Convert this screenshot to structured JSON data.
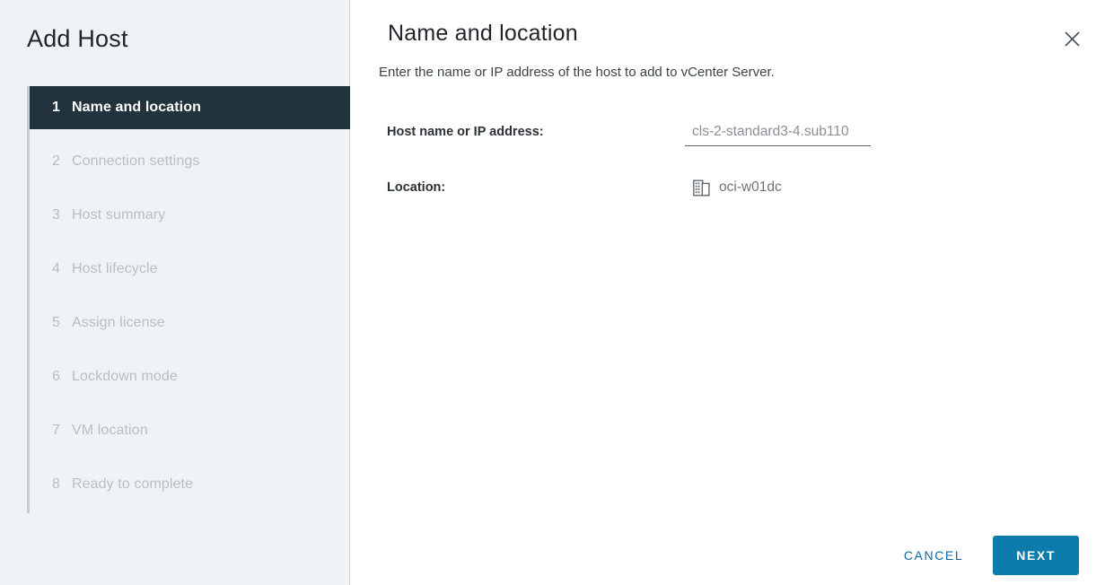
{
  "wizard": {
    "title": "Add Host",
    "close_icon": "close-icon"
  },
  "sidebar": {
    "steps": [
      {
        "number": "1",
        "label": "Name and location",
        "active": true
      },
      {
        "number": "2",
        "label": "Connection settings",
        "active": false
      },
      {
        "number": "3",
        "label": "Host summary",
        "active": false
      },
      {
        "number": "4",
        "label": "Host lifecycle",
        "active": false
      },
      {
        "number": "5",
        "label": "Assign license",
        "active": false
      },
      {
        "number": "6",
        "label": "Lockdown mode",
        "active": false
      },
      {
        "number": "7",
        "label": "VM location",
        "active": false
      },
      {
        "number": "8",
        "label": "Ready to complete",
        "active": false
      }
    ]
  },
  "content": {
    "title": "Name and location",
    "subtitle": "Enter the name or IP address of the host to add to vCenter Server.",
    "fields": {
      "host": {
        "label": "Host name or IP address:",
        "value": "cls-2-standard3-4.sub110",
        "placeholder": ""
      },
      "location": {
        "label": "Location:",
        "icon": "datacenter-icon",
        "value": "oci-w01dc"
      }
    }
  },
  "footer": {
    "cancel_label": "CANCEL",
    "next_label": "NEXT"
  },
  "colors": {
    "accent": "#0d7cac",
    "link": "#0b6aa2",
    "sidebar_bg": "#eff3f6",
    "active_step_bg": "#22333d",
    "rail": "#c3ced6"
  }
}
